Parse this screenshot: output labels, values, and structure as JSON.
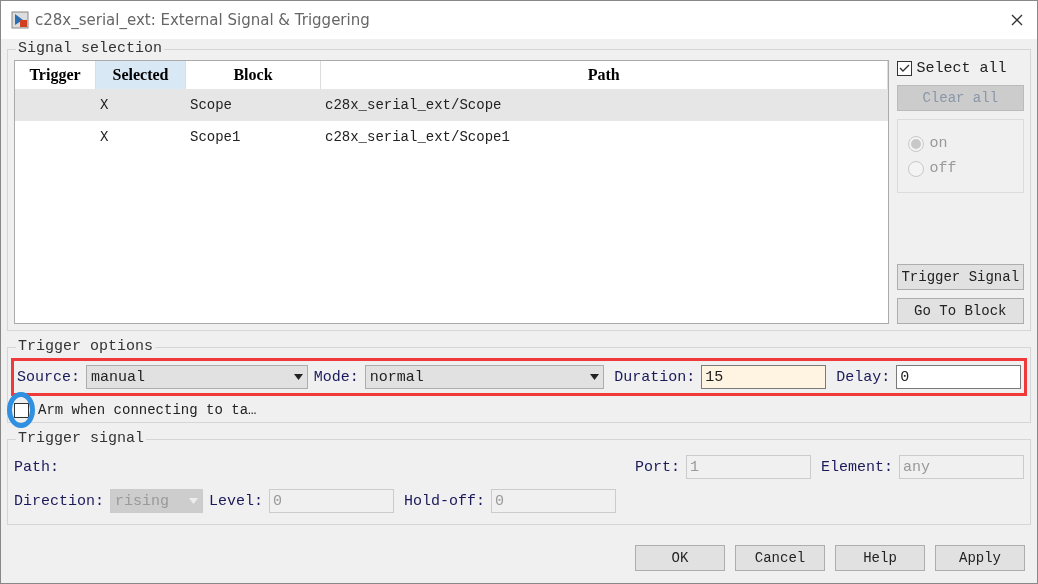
{
  "window": {
    "title": "c28x_serial_ext: External Signal & Triggering"
  },
  "signal_selection": {
    "title": "Signal selection",
    "table": {
      "columns": [
        {
          "label": "Trigger",
          "selected": false
        },
        {
          "label": "Selected",
          "selected": true
        },
        {
          "label": "Block",
          "selected": false
        },
        {
          "label": "Path",
          "selected": false
        }
      ],
      "rows": [
        {
          "trigger": "",
          "selected_mark": "X",
          "block": "Scope",
          "path": "c28x_serial_ext/Scope",
          "selected": true
        },
        {
          "trigger": "",
          "selected_mark": "X",
          "block": "Scope1",
          "path": "c28x_serial_ext/Scope1",
          "selected": false
        }
      ]
    },
    "select_all": {
      "label": "Select all",
      "checked": true
    },
    "clear_all": {
      "label": "Clear all",
      "disabled": true
    },
    "radios": [
      {
        "label": "on",
        "selected": true,
        "disabled": true
      },
      {
        "label": "off",
        "selected": false,
        "disabled": true
      }
    ],
    "trigger_signal_button": "Trigger Signal",
    "go_to_block_button": "Go To Block"
  },
  "trigger_options": {
    "title": "Trigger options",
    "source": {
      "label": "Source:",
      "value": "manual"
    },
    "mode": {
      "label": "Mode:",
      "value": "normal"
    },
    "duration": {
      "label": "Duration:",
      "value": "15"
    },
    "delay": {
      "label": "Delay:",
      "value": "0"
    },
    "arm": {
      "label": "Arm when connecting to ta…",
      "checked": false
    }
  },
  "trigger_signal": {
    "title": "Trigger signal",
    "path_label": "Path:",
    "port": {
      "label": "Port:",
      "value": "1",
      "disabled": true
    },
    "element": {
      "label": "Element:",
      "value": "any",
      "disabled": true
    },
    "direction": {
      "label": "Direction:",
      "value": "rising",
      "disabled": true
    },
    "level": {
      "label": "Level:",
      "value": "0",
      "disabled": true
    },
    "hold_off": {
      "label": "Hold-off:",
      "value": "0",
      "disabled": true
    }
  },
  "buttons": [
    "OK",
    "Cancel",
    "Help",
    "Apply"
  ]
}
